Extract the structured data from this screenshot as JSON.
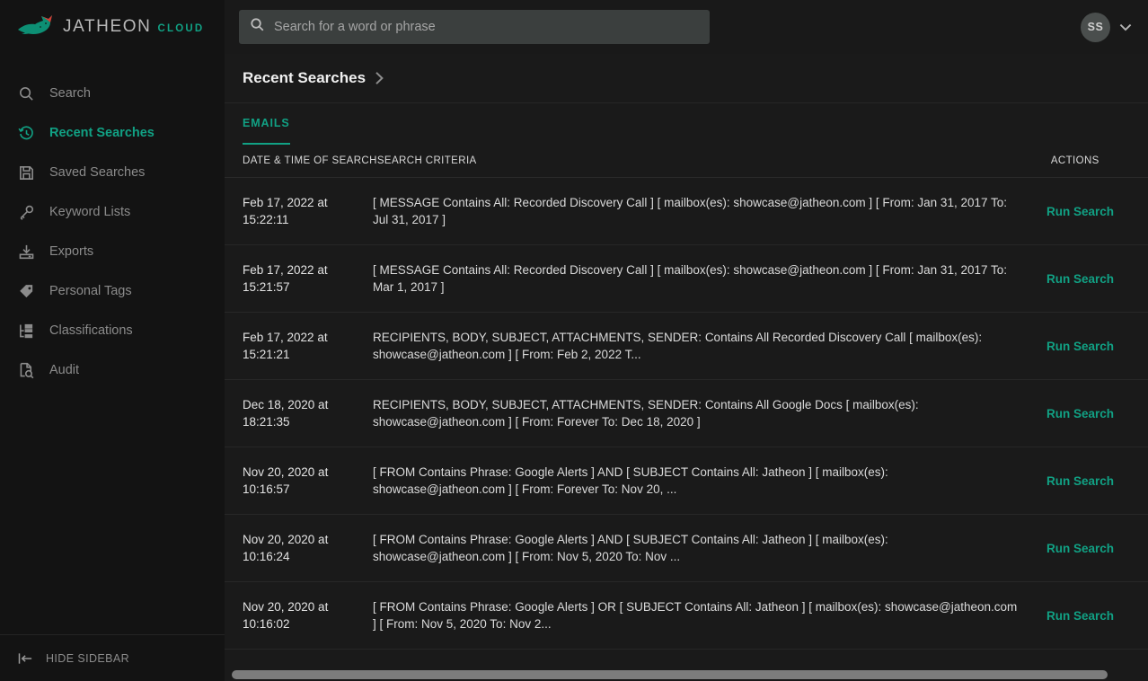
{
  "brand": {
    "name": "JATHEON",
    "suffix": "CLOUD",
    "logo_icon": "fox-logo-icon",
    "accent_color": "#11a184",
    "logo_red": "#d63c34"
  },
  "sidebar": {
    "items": [
      {
        "label": "Search",
        "icon": "search-icon",
        "active": false
      },
      {
        "label": "Recent Searches",
        "icon": "history-clock-icon",
        "active": true
      },
      {
        "label": "Saved Searches",
        "icon": "floppy-save-icon",
        "active": false
      },
      {
        "label": "Keyword Lists",
        "icon": "key-icon",
        "active": false
      },
      {
        "label": "Exports",
        "icon": "download-tray-icon",
        "active": false
      },
      {
        "label": "Personal Tags",
        "icon": "tag-icon",
        "active": false
      },
      {
        "label": "Classifications",
        "icon": "sitemap-tree-icon",
        "active": false
      },
      {
        "label": "Audit",
        "icon": "document-search-icon",
        "active": false
      }
    ],
    "footer": {
      "label": "HIDE SIDEBAR",
      "icon": "collapse-left-icon"
    }
  },
  "topbar": {
    "search_placeholder": "Search for a word or phrase",
    "search_value": "",
    "search_icon": "search-icon",
    "avatar_initials": "SS",
    "caret_icon": "chevron-down-icon"
  },
  "page": {
    "title": "Recent Searches",
    "breadcrumb_icon": "chevron-right-icon"
  },
  "tabs": [
    {
      "label": "EMAILS",
      "active": true
    }
  ],
  "table": {
    "columns": [
      {
        "key": "date",
        "label": "DATE & TIME OF SEARCH"
      },
      {
        "key": "criteria",
        "label": "SEARCH CRITERIA"
      },
      {
        "key": "actions",
        "label": "ACTIONS"
      }
    ],
    "rows": [
      {
        "date": "Feb 17, 2022 at 15:22:11",
        "criteria": "[ MESSAGE Contains All: Recorded Discovery Call ] [ mailbox(es): showcase@jatheon.com ] [ From: Jan 31, 2017 To: Jul 31, 2017 ]",
        "action": "Run Search"
      },
      {
        "date": "Feb 17, 2022 at 15:21:57",
        "criteria": "[ MESSAGE Contains All: Recorded Discovery Call ] [ mailbox(es): showcase@jatheon.com ] [ From: Jan 31, 2017 To: Mar 1, 2017 ]",
        "action": "Run Search"
      },
      {
        "date": "Feb 17, 2022 at 15:21:21",
        "criteria": "RECIPIENTS, BODY, SUBJECT, ATTACHMENTS, SENDER: Contains All Recorded Discovery Call [ mailbox(es): showcase@jatheon.com ] [ From: Feb 2, 2022 T...",
        "action": "Run Search"
      },
      {
        "date": "Dec 18, 2020 at 18:21:35",
        "criteria": "RECIPIENTS, BODY, SUBJECT, ATTACHMENTS, SENDER: Contains All Google Docs [ mailbox(es): showcase@jatheon.com ] [ From: Forever To: Dec 18, 2020 ]",
        "action": "Run Search"
      },
      {
        "date": "Nov 20, 2020 at 10:16:57",
        "criteria": "[ FROM Contains Phrase: Google Alerts ] AND [ SUBJECT Contains All: Jatheon ] [ mailbox(es): showcase@jatheon.com ] [ From: Forever To: Nov 20, ...",
        "action": "Run Search"
      },
      {
        "date": "Nov 20, 2020 at 10:16:24",
        "criteria": "[ FROM Contains Phrase: Google Alerts ] AND [ SUBJECT Contains All: Jatheon ] [ mailbox(es): showcase@jatheon.com ] [ From: Nov 5, 2020 To: Nov ...",
        "action": "Run Search"
      },
      {
        "date": "Nov 20, 2020 at 10:16:02",
        "criteria": "[ FROM Contains Phrase: Google Alerts ] OR [ SUBJECT Contains All: Jatheon ] [ mailbox(es): showcase@jatheon.com ] [ From: Nov 5, 2020 To: Nov 2...",
        "action": "Run Search"
      }
    ]
  }
}
